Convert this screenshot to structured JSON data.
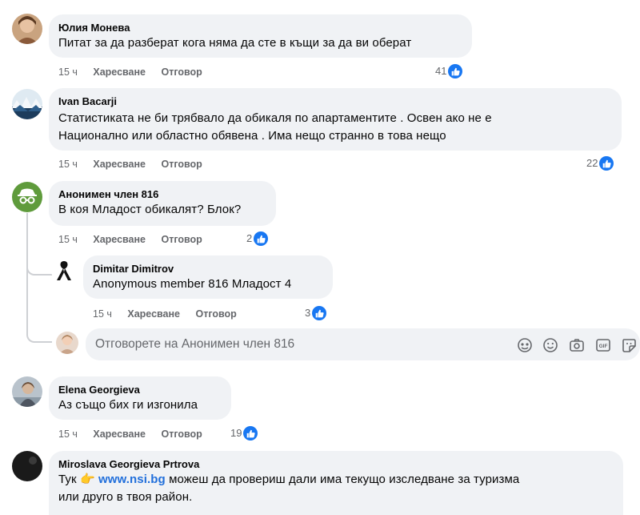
{
  "actions": {
    "like": "Харесване",
    "reply": "Отговор"
  },
  "comments": [
    {
      "author": "Юлия Монева",
      "lines": [
        "Питат за да разберат кога няма да сте в къщи за да ви оберат"
      ],
      "time": "15 ч",
      "reactions": "41"
    },
    {
      "author": "Ivan Bacarji",
      "lines": [
        "Статистиката не би трябвало да обикаля по апартаментите . Освен ако не е",
        "Национално или областно обявена . Има нещо странно в това нещо"
      ],
      "time": "15 ч",
      "reactions": "22"
    },
    {
      "author": "Анонимен член 816",
      "lines": [
        "В коя Младост обикалят? Блок?"
      ],
      "time": "15 ч",
      "reactions": "2"
    },
    {
      "author": "Dimitar Dimitrov",
      "lines": [
        "Anonymous member 816 Младост 4"
      ],
      "time": "15 ч",
      "reactions": "3"
    },
    {
      "author": "Elena Georgieva",
      "lines": [
        "Аз също бих ги изгонила"
      ],
      "time": "15 ч",
      "reactions": "19"
    },
    {
      "author": "Miroslava Georgieva Prtrova",
      "lines": [
        "или друго в твоя район."
      ],
      "text_pre": "Тук ",
      "emoji": "👉",
      "link": "www.nsi.bg",
      "text_post": " можеш да провериш дали има текущо изследване за туризма"
    }
  ],
  "reply_box": {
    "placeholder": "Отговорете на Анонимен член 816"
  },
  "icons": {
    "like": "like-thumb-icon",
    "tools": [
      "avatar-sticker-icon",
      "emoji-icon",
      "camera-icon",
      "gif-icon",
      "sticker-icon"
    ]
  },
  "colors": {
    "accent": "#1877f2",
    "link": "#216fdb",
    "bubble": "#f0f2f5",
    "meta": "#65676b"
  }
}
